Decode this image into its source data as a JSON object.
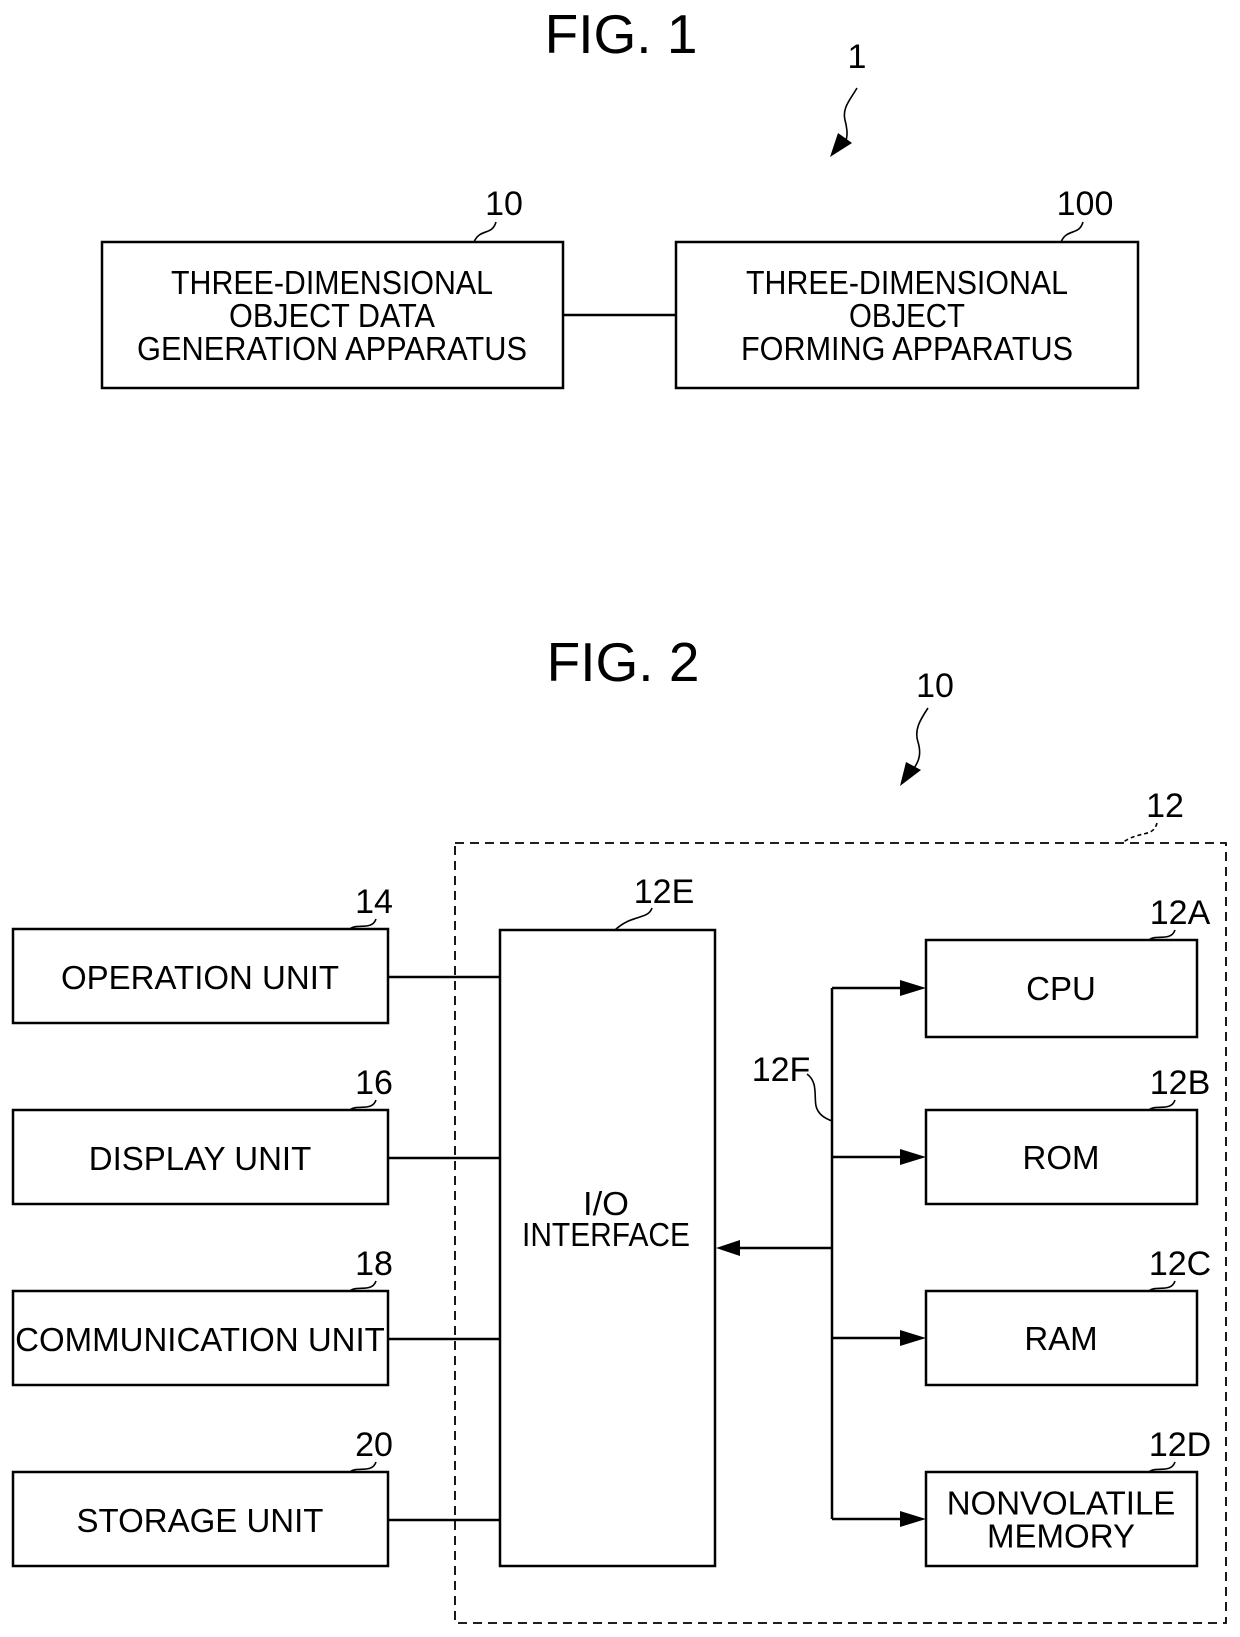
{
  "fig1": {
    "title": "FIG. 1",
    "system_ref": "1",
    "blocks": [
      {
        "ref": "10",
        "lines": [
          "THREE-DIMENSIONAL",
          "OBJECT DATA",
          "GENERATION APPARATUS"
        ]
      },
      {
        "ref": "100",
        "lines": [
          "THREE-DIMENSIONAL",
          "OBJECT",
          "FORMING APPARATUS"
        ]
      }
    ]
  },
  "fig2": {
    "title": "FIG. 2",
    "apparatus_ref": "10",
    "controller_ref": "12",
    "bus_ref": "12F",
    "io": {
      "ref": "12E",
      "lines": [
        "I/O",
        "INTERFACE"
      ]
    },
    "left_units": [
      {
        "ref": "14",
        "label": "OPERATION UNIT"
      },
      {
        "ref": "16",
        "label": "DISPLAY UNIT"
      },
      {
        "ref": "18",
        "label": "COMMUNICATION UNIT"
      },
      {
        "ref": "20",
        "label": "STORAGE UNIT"
      }
    ],
    "right_units": [
      {
        "ref": "12A",
        "lines": [
          "CPU"
        ]
      },
      {
        "ref": "12B",
        "lines": [
          "ROM"
        ]
      },
      {
        "ref": "12C",
        "lines": [
          "RAM"
        ]
      },
      {
        "ref": "12D",
        "lines": [
          "NONVOLATILE",
          "MEMORY"
        ]
      }
    ]
  }
}
